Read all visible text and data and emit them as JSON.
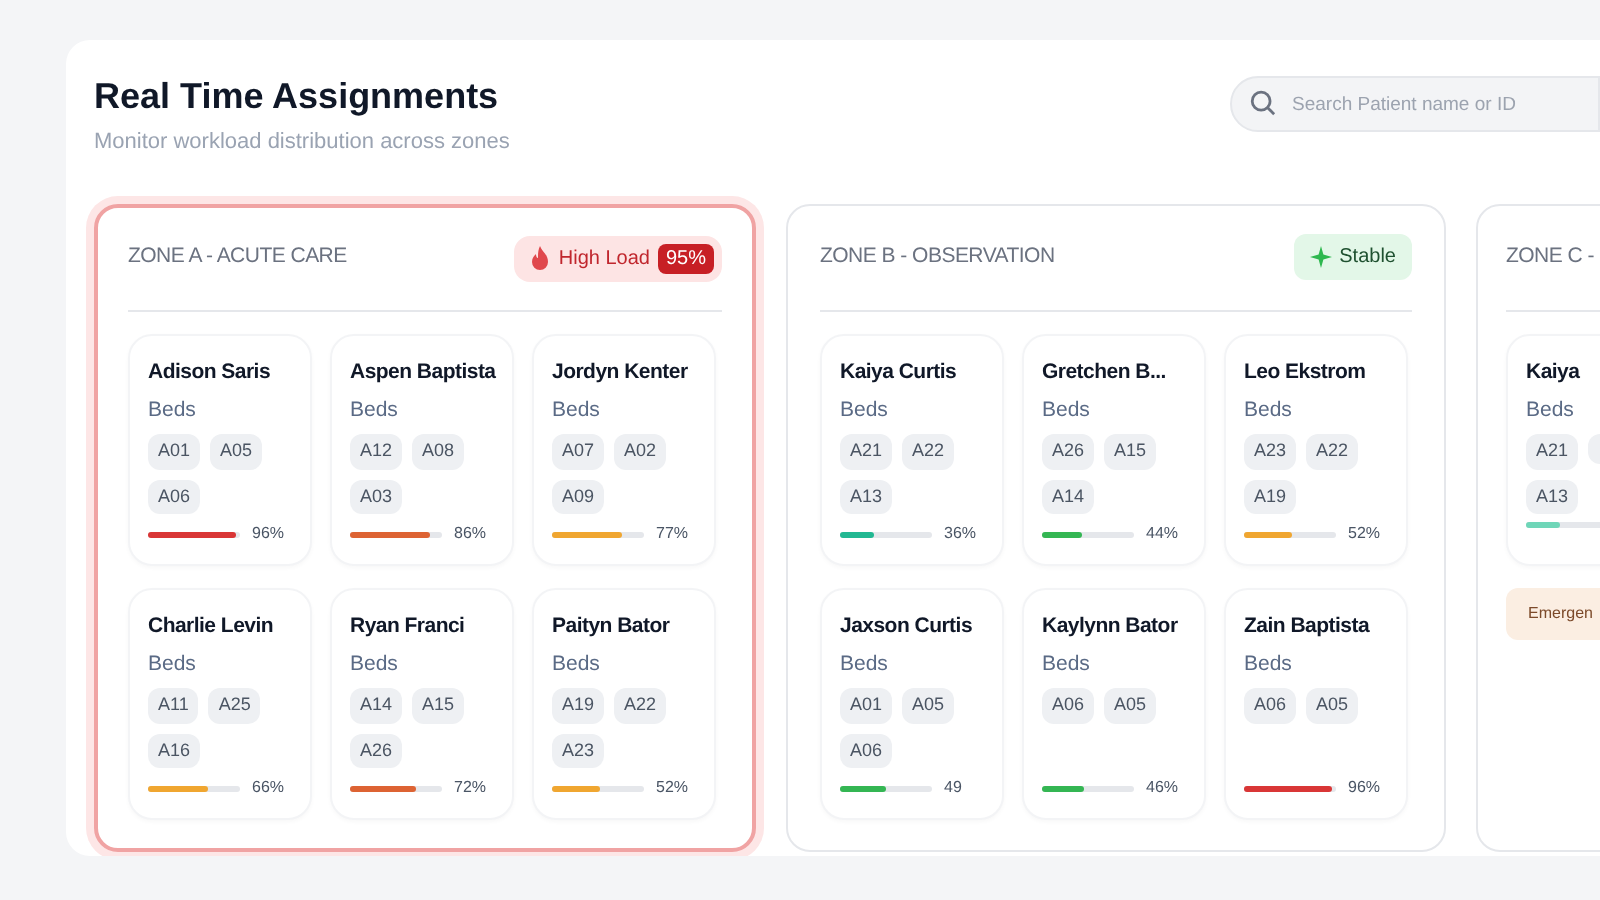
{
  "header": {
    "title": "Real Time Assignments",
    "subtitle": "Monitor workload distribution across zones"
  },
  "search": {
    "placeholder": "Search Patient name or ID"
  },
  "zones": [
    {
      "title": "ZONE A - ACUTE CARE",
      "status": {
        "kind": "high_load",
        "label": "High Load",
        "value": "95%"
      },
      "patients": [
        {
          "name": "Adison Saris",
          "beds_label": "Beds",
          "beds": [
            "A01",
            "A05",
            "A06"
          ],
          "level": 0.96,
          "reading": "96%",
          "color": "#d93636"
        },
        {
          "name": "Aspen Baptista",
          "beds_label": "Beds",
          "beds": [
            "A12",
            "A08",
            "A03"
          ],
          "level": 0.86,
          "reading": "86%",
          "color": "#dd6333"
        },
        {
          "name": "Jordyn Kenter",
          "beds_label": "Beds",
          "beds": [
            "A07",
            "A02",
            "A09"
          ],
          "level": 0.77,
          "reading": "77%",
          "color": "#f0a630"
        },
        {
          "name": "Charlie Levin",
          "beds_label": "Beds",
          "beds": [
            "A11",
            "A25",
            "A16"
          ],
          "level": 0.66,
          "reading": "66%",
          "color": "#f0a630"
        },
        {
          "name": "Ryan Franci",
          "beds_label": "Beds",
          "beds": [
            "A14",
            "A15",
            "A26"
          ],
          "level": 0.72,
          "reading": "72%",
          "color": "#dd6333"
        },
        {
          "name": "Paityn Bator",
          "beds_label": "Beds",
          "beds": [
            "A19",
            "A22",
            "A23"
          ],
          "level": 0.52,
          "reading": "52%",
          "color": "#f0a630"
        }
      ]
    },
    {
      "title": "ZONE B - OBSERVATION",
      "status": {
        "kind": "stable",
        "label": "Stable"
      },
      "patients": [
        {
          "name": "Kaiya Curtis",
          "beds_label": "Beds",
          "beds": [
            "A21",
            "A22",
            "A13"
          ],
          "level": 0.36,
          "reading": "36%",
          "color": "#22b892"
        },
        {
          "name": "Gretchen B...",
          "beds_label": "Beds",
          "beds": [
            "A26",
            "A15",
            "A14"
          ],
          "level": 0.44,
          "reading": "44%",
          "color": "#34b653"
        },
        {
          "name": "Leo Ekstrom",
          "beds_label": "Beds",
          "beds": [
            "A23",
            "A22",
            "A19"
          ],
          "level": 0.52,
          "reading": "52%",
          "color": "#f0a630"
        },
        {
          "name": "Jaxson Curtis",
          "beds_label": "Beds",
          "beds": [
            "A01",
            "A05",
            "A06"
          ],
          "level": 0.49,
          "reading": "49",
          "color": "#34b653"
        },
        {
          "name": "Kaylynn Bator",
          "beds_label": "Beds",
          "beds": [
            "A06",
            "A05"
          ],
          "level": 0.46,
          "reading": "46%",
          "color": "#34b653"
        },
        {
          "name": "Zain Baptista",
          "beds_label": "Beds",
          "beds": [
            "A06",
            "A05"
          ],
          "level": 0.96,
          "reading": "96%",
          "color": "#d93636"
        }
      ]
    },
    {
      "title": "ZONE C -",
      "patients": [
        {
          "name": "Kaiya",
          "beds_label": "Beds",
          "beds": [
            "A21",
            "A13"
          ],
          "level": 0.36,
          "color": "#6fd6b8"
        }
      ],
      "note": "Emergen"
    }
  ]
}
